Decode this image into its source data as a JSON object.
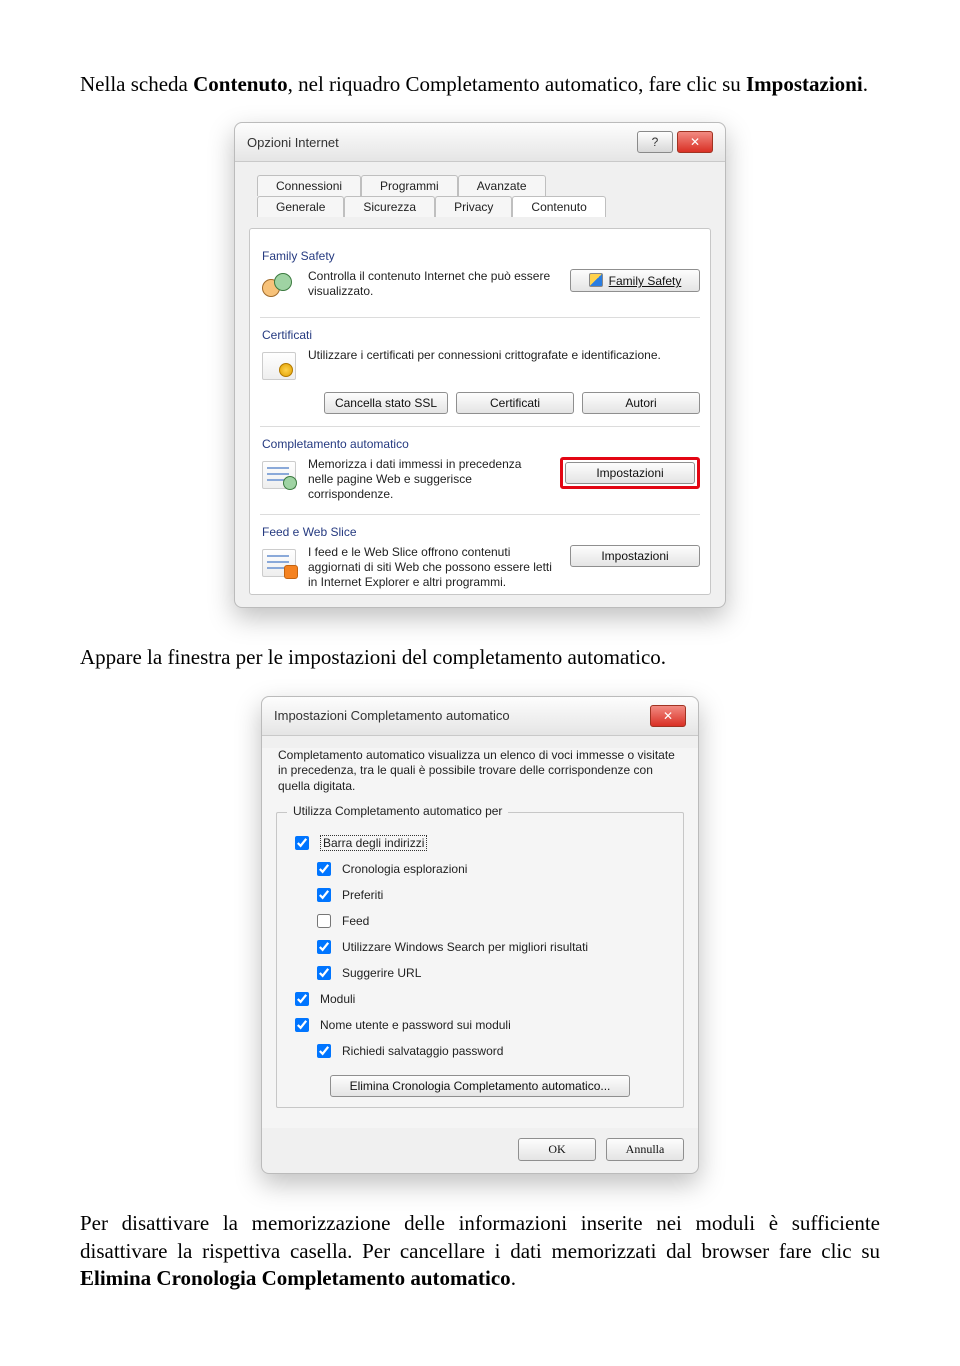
{
  "para1": {
    "t1": "Nella scheda ",
    "b1": "Contenuto",
    "t2": ", nel riquadro Completamento automatico, fare clic su ",
    "b2": "Impostazioni",
    "t3": "."
  },
  "dlg1": {
    "title": "Opzioni Internet",
    "tabs_top": [
      "Connessioni",
      "Programmi",
      "Avanzate"
    ],
    "tabs_bottom": [
      "Generale",
      "Sicurezza",
      "Privacy",
      "Contenuto"
    ],
    "sections": {
      "family": {
        "label": "Family Safety",
        "desc": "Controlla il contenuto Internet che può essere visualizzato.",
        "btn": "Family Safety"
      },
      "cert": {
        "label": "Certificati",
        "desc": "Utilizzare i certificati per connessioni crittografate e identificazione.",
        "btns": {
          "ssl": "Cancella stato SSL",
          "cert": "Certificati",
          "auth": "Autori"
        }
      },
      "auto": {
        "label": "Completamento automatico",
        "desc": "Memorizza i dati immessi in precedenza nelle pagine Web e suggerisce corrispondenze.",
        "btn": "Impostazioni"
      },
      "feed": {
        "label": "Feed e Web Slice",
        "desc": "I feed e le Web Slice offrono contenuti aggiornati di siti Web che possono essere letti in Internet Explorer e altri programmi.",
        "btn": "Impostazioni"
      }
    }
  },
  "para2": "Appare la finestra per le impostazioni del completamento automatico.",
  "dlg2": {
    "title": "Impostazioni Completamento automatico",
    "intro": "Completamento automatico visualizza un elenco di voci immesse o visitate in precedenza, tra le quali è possibile trovare delle corrispondenze con quella digitata.",
    "gb_title": "Utilizza Completamento automatico per",
    "items": {
      "addr": {
        "label": "Barra degli indirizzi",
        "checked": true,
        "focus": true,
        "indent": 0
      },
      "hist": {
        "label": "Cronologia esplorazioni",
        "checked": true,
        "indent": 1
      },
      "pref": {
        "label": "Preferiti",
        "checked": true,
        "indent": 1
      },
      "feed": {
        "label": "Feed",
        "checked": false,
        "indent": 1
      },
      "wsearch": {
        "label": "Utilizzare Windows Search per migliori risultati",
        "checked": true,
        "indent": 1
      },
      "surl": {
        "label": "Suggerire URL",
        "checked": true,
        "indent": 1
      },
      "mods": {
        "label": "Moduli",
        "checked": true,
        "indent": 0
      },
      "userpw": {
        "label": "Nome utente e password sui moduli",
        "checked": true,
        "indent": 0
      },
      "askpw": {
        "label": "Richiedi salvataggio password",
        "checked": true,
        "indent": 1
      }
    },
    "btn_clear": "Elimina Cronologia Completamento automatico...",
    "btn_ok": "OK",
    "btn_cancel": "Annulla"
  },
  "para3": {
    "t1": "Per disattivare la memorizzazione delle informazioni inserite nei moduli è sufficiente disattivare la rispettiva casella. Per cancellare i dati memorizzati dal browser fare clic su ",
    "b1": "Elimina Cronologia Completamento automatico",
    "t2": "."
  }
}
